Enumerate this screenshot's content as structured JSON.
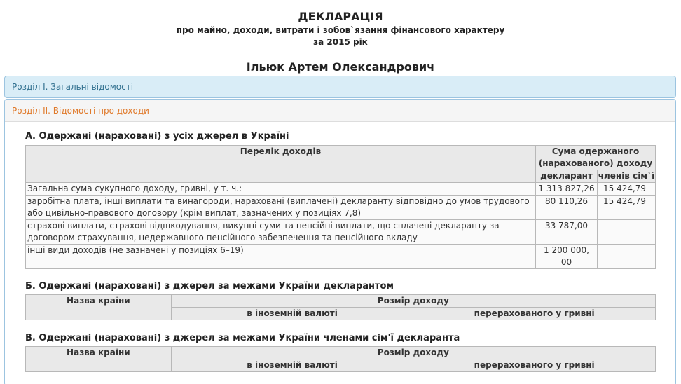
{
  "header": {
    "title": "ДЕКЛАРАЦІЯ",
    "subtitle": "про майно, доходи, витрати і зобов`язання фінансового характеру",
    "year": "за 2015 рік",
    "person": "Ільюк Артем Олександрович"
  },
  "sections": {
    "section1": "Розділ І. Загальні відомості",
    "section2": "Розділ ІІ. Відомості про доходи"
  },
  "partA": {
    "title": "А. Одержані (нараховані) з усіх джерел в Україні",
    "col_list": "Перелік доходів",
    "col_sum": "Сума одержаного (нарахованого) доходу",
    "col_declarant": "декларант",
    "col_family": "членів сім`ї",
    "rows": [
      {
        "label": "Загальна сума сукупного доходу, гривні, у т. ч.:",
        "declarant": "1 313 827,26",
        "family": "15 424,79"
      },
      {
        "label": "заробітна плата, інші виплати та винагороди, нараховані (виплачені) декларанту відповідно до умов трудового або цивільно-правового договору (крім виплат, зазначених у позиціях 7,8)",
        "declarant": "80 110,26",
        "family": "15 424,79"
      },
      {
        "label": "страхові виплати, страхові відшкодування, викупні суми та пенсійні виплати, що сплачені декларанту за договором страхування, недержавного пенсійного забезпечення та пенсійного вкладу",
        "declarant": "33 787,00",
        "family": ""
      },
      {
        "label": "інші види доходів (не зазначені у позиціях 6–19)",
        "declarant": "1 200 000, 00",
        "family": ""
      }
    ]
  },
  "partB": {
    "title": "Б. Одержані (нараховані) з джерел за межами України декларантом",
    "col_country": "Назва країни",
    "col_amount": "Розмір доходу",
    "col_foreign": "в іноземній валюті",
    "col_uah": "перерахованого у гривні"
  },
  "partC": {
    "title": "В. Одержані (нараховані) з джерел за межами України членами сім'ї декларанта",
    "col_country": "Назва країни",
    "col_amount": "Розмір доходу",
    "col_foreign": "в іноземній валюті",
    "col_uah": "перерахованого у гривні"
  }
}
